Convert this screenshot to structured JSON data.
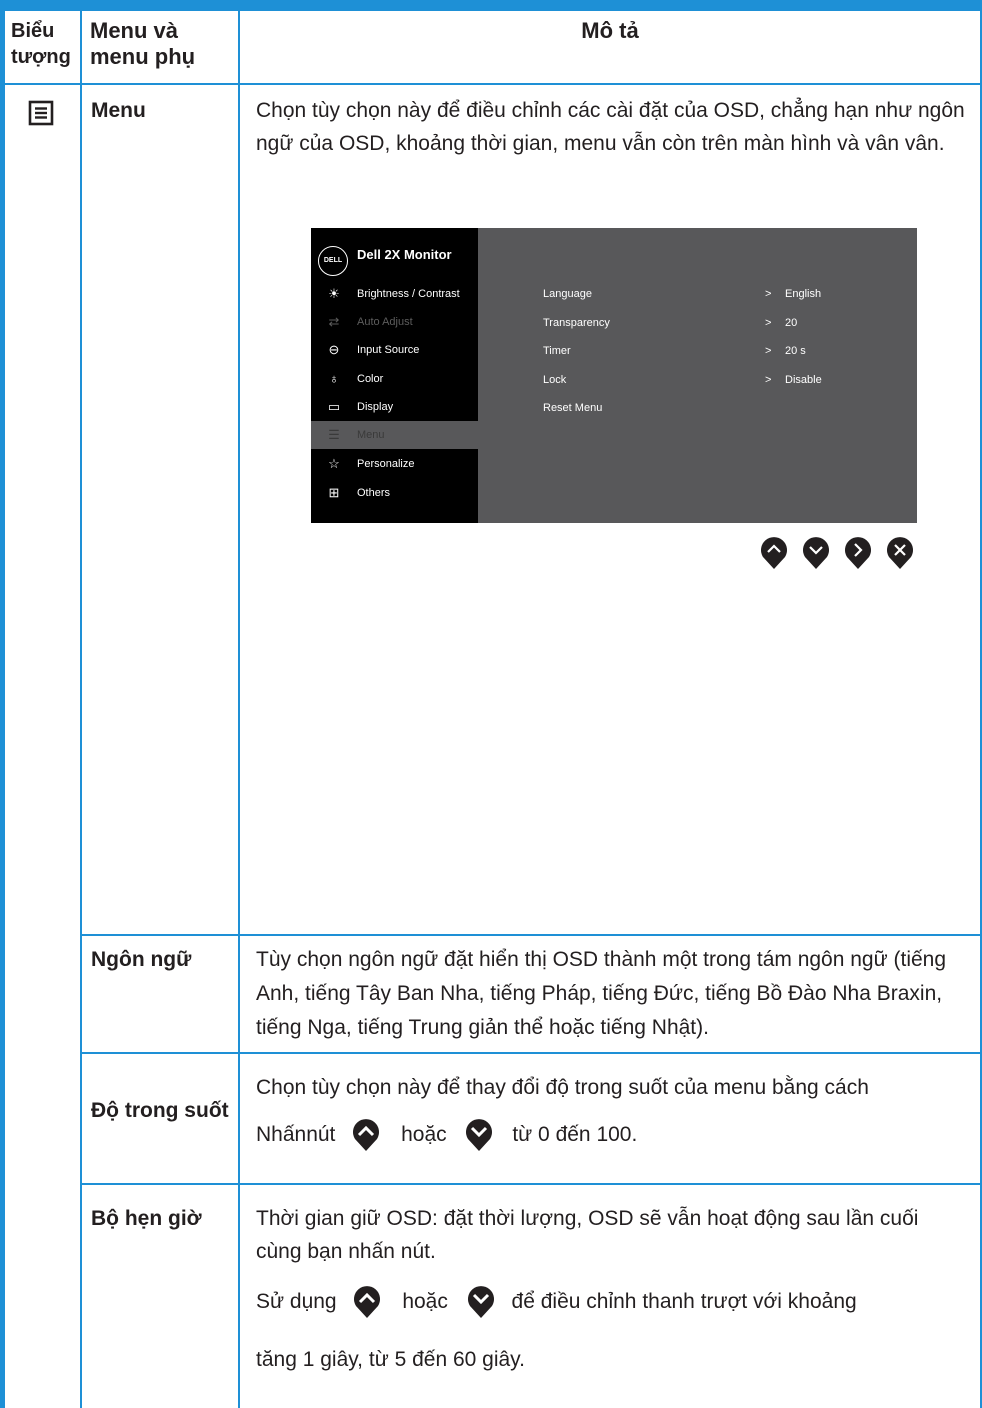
{
  "header": {
    "col1": "Biểu tượng",
    "col2": "Menu và menu phụ",
    "col3": "Mô tả"
  },
  "menu_row": {
    "icon": "menu-list-icon",
    "name": "Menu",
    "description": "Chọn tùy chọn này để điều chỉnh các cài đặt của OSD, chẳng hạn như ngôn ngữ của OSD, khoảng thời gian, menu vẫn còn trên màn hình và vân vân."
  },
  "osd": {
    "logo": "DELL",
    "title": "Dell 2X Monitor",
    "side_items": [
      {
        "icon": "brightness-icon",
        "label": "Brightness / Contrast",
        "state": "normal"
      },
      {
        "icon": "auto-adjust-icon",
        "label": "Auto Adjust",
        "state": "dim"
      },
      {
        "icon": "input-source-icon",
        "label": "Input Source",
        "state": "normal"
      },
      {
        "icon": "color-icon",
        "label": "Color",
        "state": "normal"
      },
      {
        "icon": "display-icon",
        "label": "Display",
        "state": "normal"
      },
      {
        "icon": "menu-icon",
        "label": "Menu",
        "state": "active"
      },
      {
        "icon": "star-icon",
        "label": "Personalize",
        "state": "normal"
      },
      {
        "icon": "others-icon",
        "label": "Others",
        "state": "normal"
      }
    ],
    "settings": [
      {
        "label": "Language",
        "value": "English"
      },
      {
        "label": "Transparency",
        "value": "20"
      },
      {
        "label": "Timer",
        "value": "20 s"
      },
      {
        "label": "Lock",
        "value": "Disable"
      },
      {
        "label": "Reset Menu",
        "value": ""
      }
    ],
    "chevron": ">",
    "colors": {
      "panel": "#58585a",
      "sidebar": "#000000"
    },
    "nav_buttons": [
      "up-arrow-icon",
      "down-arrow-icon",
      "right-arrow-icon",
      "close-icon"
    ]
  },
  "language_row": {
    "name": "Ngôn ngữ",
    "description": "Tùy chọn ngôn ngữ đặt hiển thị OSD thành một trong tám ngôn ngữ (tiếng Anh, tiếng Tây Ban Nha, tiếng Pháp, tiếng Đức, tiếng Bồ Đào Nha Braxin, tiếng Nga, tiếng Trung giản thể hoặc tiếng Nhật)."
  },
  "transparency_row": {
    "name": "Độ trong suốt",
    "line1": "Chọn tùy chọn này để thay đổi độ trong suốt của menu bằng cách",
    "press": "Nhấnnút",
    "or": "hoặc",
    "range": "từ 0 đến 100."
  },
  "timer_row": {
    "name": "Bộ hẹn giờ",
    "line1": "Thời gian giữ OSD: đặt thời lượng, OSD sẽ vẫn hoạt động sau lần cuối cùng bạn nhấn nút.",
    "use": "Sử dụng",
    "or": "hoặc",
    "adjust": "để điều chỉnh thanh trượt với khoảng",
    "step": "tăng 1 giây, từ 5 đến 60 giây."
  },
  "colors": {
    "table_border": "#1e90d6",
    "text": "#231f20",
    "button": "#231f20"
  }
}
